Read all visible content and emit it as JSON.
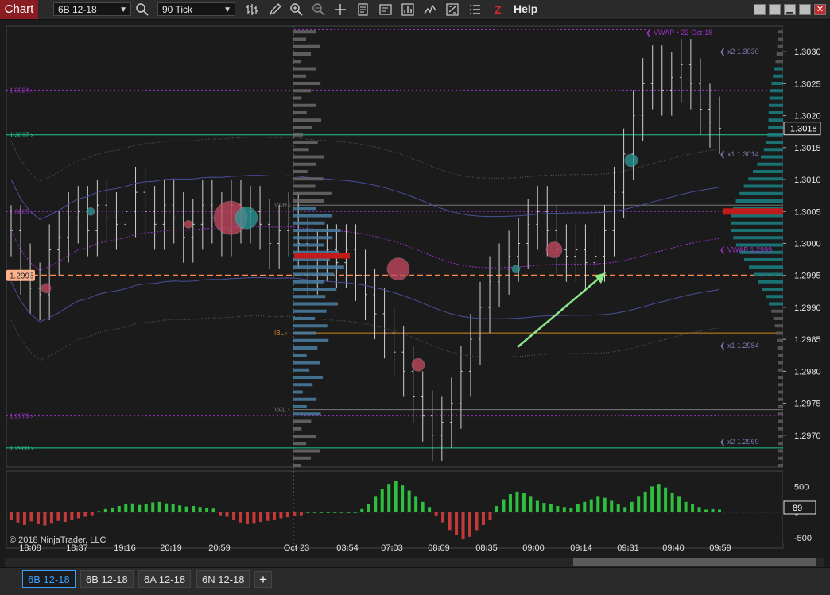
{
  "toolbar": {
    "chart_label": "Chart",
    "instrument": "6B 12-18",
    "interval": "90 Tick",
    "help_label": "Help",
    "z_label": "Z",
    "icons": [
      "search-icon",
      "bar-type-icon",
      "pencil-icon",
      "zoom-in-icon",
      "zoom-out-icon",
      "crosshair-icon",
      "properties-icon",
      "template-icon",
      "strategy-icon",
      "indicator-icon",
      "data-box-icon",
      "list-icon"
    ]
  },
  "tabs": [
    "6B 12-18",
    "6B 12-18",
    "6A 12-18",
    "6N 12-18"
  ],
  "colors": {
    "background": "#1b1b1b",
    "up": "#2fbf3f",
    "down": "#c43a3a",
    "accent_teal": "#1c9a9a",
    "vwap": "#9a32c8",
    "orange": "#ff8a4a"
  },
  "chart_data": {
    "type": "candlestick",
    "instrument": "6B 12-18",
    "ylim": [
      1.2965,
      1.3034
    ],
    "y_ticks": [
      "1.3030",
      "1.3025",
      "1.3020",
      "1.3015",
      "1.3010",
      "1.3005",
      "1.3000",
      "1.2995",
      "1.2990",
      "1.2985",
      "1.2980",
      "1.2975",
      "1.2970"
    ],
    "x_ticks": [
      "18:08",
      "18:37",
      "19:16",
      "20:19",
      "20:59",
      "Oct 23",
      "03:54",
      "07:03",
      "08:09",
      "08:35",
      "09:00",
      "09:14",
      "09:31",
      "09:40",
      "09:59"
    ],
    "price_marker": "1.3018",
    "session_divider_label": "Oct 23",
    "closes": [
      1.3002,
      1.2996,
      1.2993,
      1.2992,
      1.2999,
      1.3001,
      1.3004,
      1.3005,
      1.3002,
      1.3006,
      1.3004,
      1.3003,
      1.3005,
      1.3008,
      1.3005,
      1.3003,
      1.3006,
      1.3004,
      1.3001,
      1.3003,
      1.3006,
      1.3004,
      1.3002,
      1.3006,
      1.3004,
      1.3005,
      1.3003,
      1.3,
      1.3002,
      1.3004,
      1.3,
      1.2996,
      1.2998,
      1.2999,
      1.2997,
      1.2999,
      1.2995,
      1.2992,
      1.2989,
      1.2986,
      1.2983,
      1.298,
      1.2976,
      1.2973,
      1.297,
      1.2972,
      1.2975,
      1.298,
      1.2985,
      1.299,
      1.2994,
      1.2996,
      1.2998,
      1.3,
      1.3003,
      1.3005,
      1.3002,
      1.2999,
      1.2998,
      1.2999,
      1.2997,
      1.2998,
      1.3002,
      1.3008,
      1.3014,
      1.302,
      1.3025,
      1.3027,
      1.3024,
      1.3026,
      1.3028,
      1.3025,
      1.3021,
      1.3019,
      1.3018
    ],
    "levels": [
      {
        "label": "1.3024",
        "y": 1.3024,
        "color": "#9a32c8",
        "style": "dotted"
      },
      {
        "label": "1.3017",
        "y": 1.3017,
        "color": "#1fc88a",
        "style": "solid"
      },
      {
        "label": "1.3005",
        "y": 1.3005,
        "color": "#9a32c8",
        "style": "dotted"
      },
      {
        "label": "1.2995",
        "y": 1.2995,
        "color": "#ff8a4a",
        "style": "dashed"
      },
      {
        "label": "1.2973",
        "y": 1.2973,
        "color": "#9a32c8",
        "style": "dotted"
      },
      {
        "label": "1.2968",
        "y": 1.2968,
        "color": "#1fc88a",
        "style": "solid"
      },
      {
        "label": "VAH",
        "y": 1.3006,
        "color": "#777777",
        "style": "solid"
      },
      {
        "label": "VAL",
        "y": 1.2974,
        "color": "#777777",
        "style": "solid"
      },
      {
        "label": "IBL",
        "y": 1.2986,
        "color": "#d4871c",
        "style": "solid"
      }
    ],
    "right_labels": [
      "VWAP • 22-Oct-18",
      "x2 1.3030",
      "x1 1.3014",
      "VWAP 1.2999",
      "x1 1.2984",
      "x2 1.2969"
    ],
    "volume_panel": {
      "ylim": [
        -700,
        800
      ],
      "y_ticks": [
        "500",
        "0",
        "-500"
      ],
      "current": "89",
      "values": [
        -150,
        -200,
        -250,
        -180,
        -220,
        -260,
        -210,
        -170,
        -190,
        -150,
        -120,
        -90,
        -60,
        20,
        60,
        90,
        120,
        150,
        170,
        140,
        160,
        190,
        200,
        170,
        150,
        130,
        110,
        120,
        100,
        80,
        70,
        -60,
        -90,
        -150,
        -200,
        -230,
        -210,
        -190,
        -170,
        -150,
        -120,
        -100,
        -80,
        -60,
        0,
        0,
        0,
        0,
        0,
        0,
        0,
        0,
        60,
        150,
        300,
        450,
        550,
        600,
        520,
        420,
        300,
        200,
        100,
        -80,
        -200,
        -350,
        -450,
        -520,
        -480,
        -350,
        -250,
        -150,
        120,
        250,
        350,
        400,
        380,
        300,
        220,
        180,
        150,
        120,
        100,
        80,
        150,
        200,
        250,
        300,
        280,
        220,
        150,
        100,
        200,
        300,
        400,
        500,
        550,
        480,
        380,
        300,
        200,
        150,
        100,
        50,
        60,
        50
      ]
    },
    "copyright": "© 2018 NinjaTrader, LLC"
  }
}
